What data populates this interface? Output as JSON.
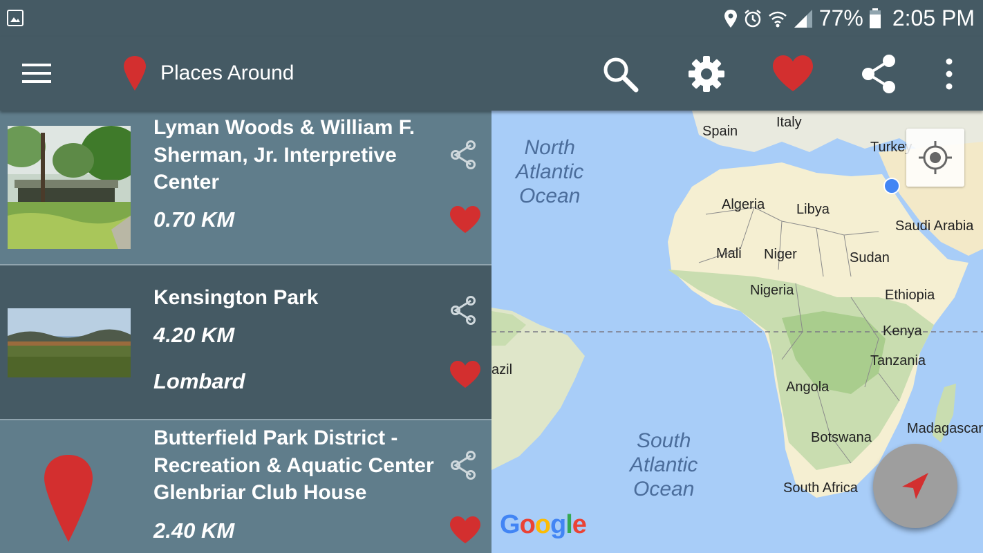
{
  "status_bar": {
    "battery": "77%",
    "time": "2:05 PM"
  },
  "toolbar": {
    "title": "Places Around"
  },
  "places": [
    {
      "name": "Lyman Woods & William F. Sherman, Jr. Interpretive Center",
      "distance": "0.70 KM",
      "city": ""
    },
    {
      "name": "Kensington Park",
      "distance": "4.20 KM",
      "city": "Lombard"
    },
    {
      "name": "Butterfield Park District - Recreation & Aquatic Center Glenbriar Club House",
      "distance": "2.40 KM",
      "city": ""
    }
  ],
  "map": {
    "oceans": [
      "North Atlantic Ocean",
      "South Atlantic Ocean"
    ],
    "countries": [
      "Spain",
      "Italy",
      "Turkey",
      "Algeria",
      "Libya",
      "Saudi Arabia",
      "Mali",
      "Niger",
      "Sudan",
      "Nigeria",
      "Ethiopia",
      "Kenya",
      "azil",
      "Tanzania",
      "Angola",
      "Botswana",
      "Madagascar",
      "South Africa"
    ],
    "logo": "Google"
  },
  "colors": {
    "toolbar": "#455a64",
    "accent_red": "#d32f2f",
    "item_light": "#607d8b",
    "item_dark": "#455a64"
  }
}
